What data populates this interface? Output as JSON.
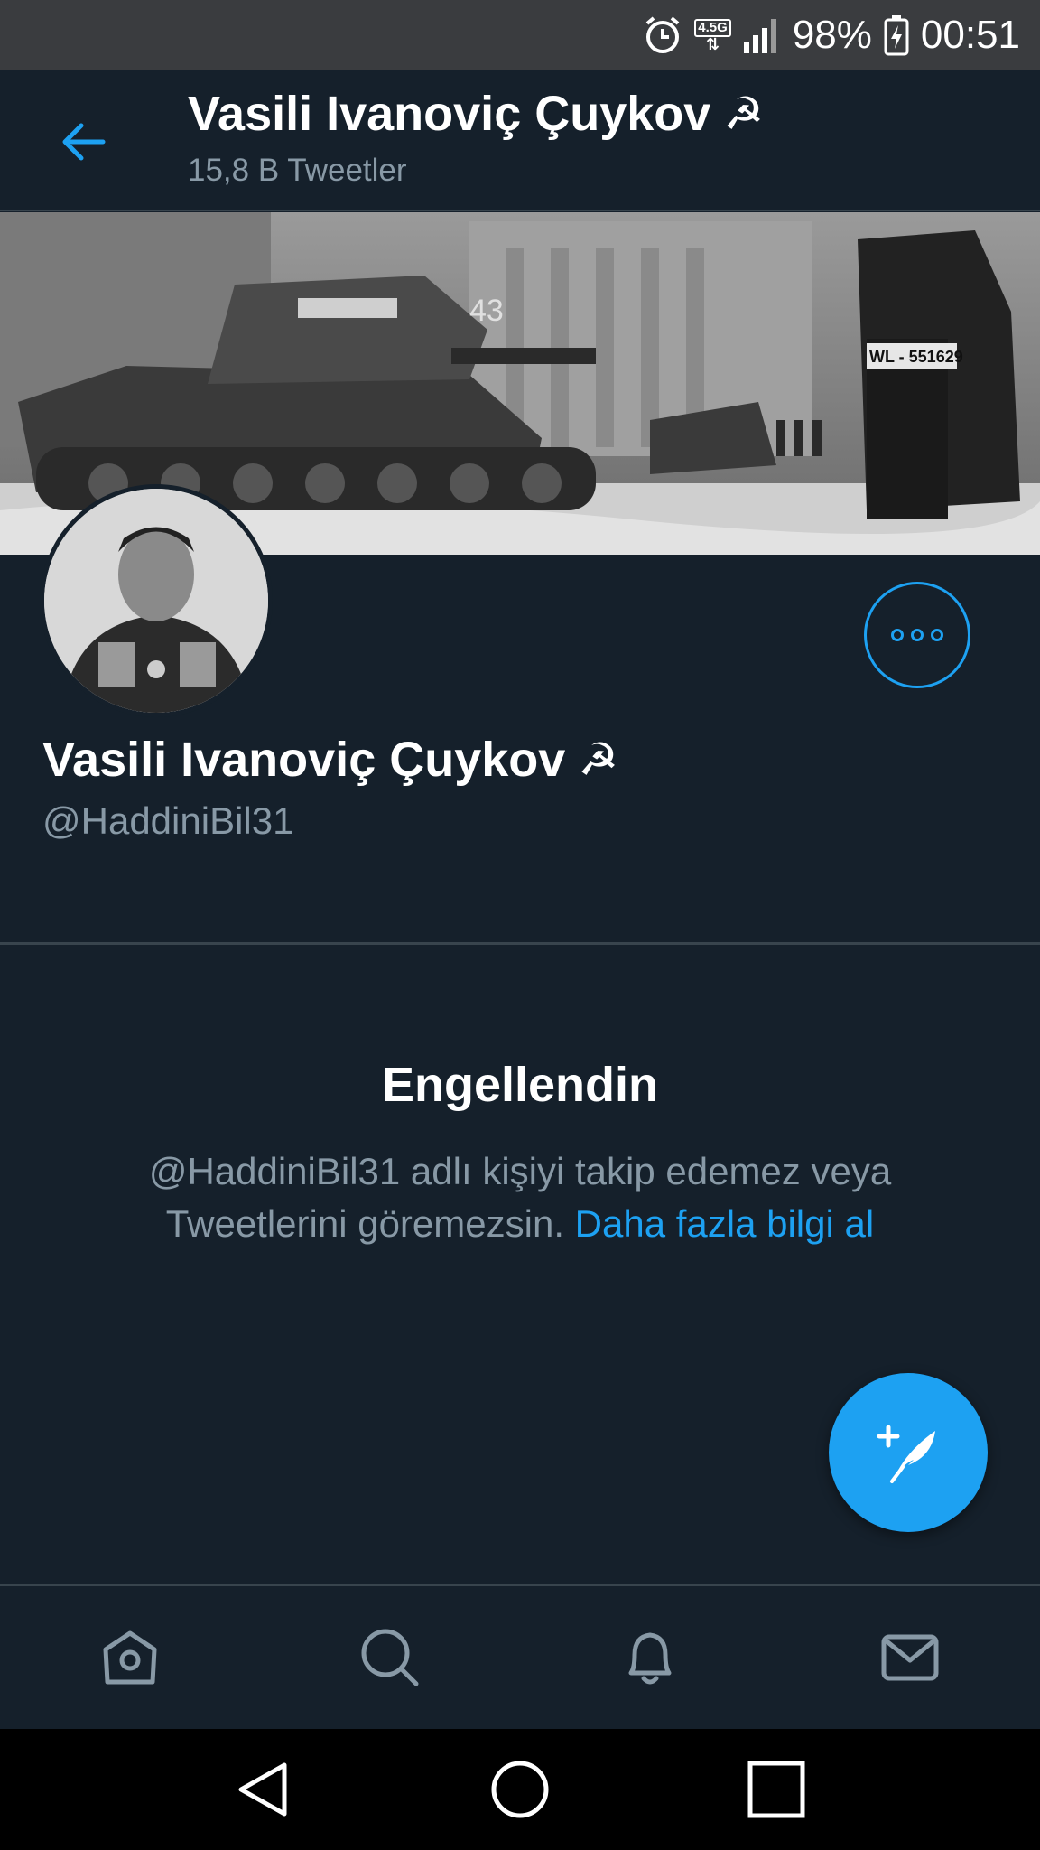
{
  "status_bar": {
    "network": "4.5G",
    "battery": "98%",
    "time": "00:51"
  },
  "header": {
    "title": "Vasili Ivanoviç Çuykov",
    "subtitle": "15,8 B Tweetler",
    "title_emoji": "☭"
  },
  "profile": {
    "name": "Vasili Ivanoviç Çuykov",
    "name_emoji": "☭",
    "handle": "@HaddiniBil31"
  },
  "blocked": {
    "title": "Engellendin",
    "message": "@HaddiniBil31 adlı kişiyi takip edemez veya Tweetlerini göremezsin.",
    "link": "Daha fazla bilgi al"
  },
  "banner": {
    "plate_text": "WL - 551629",
    "tank_number": "43"
  },
  "colors": {
    "background": "#15202b",
    "accent": "#1da1f2",
    "muted_text": "#8899a6",
    "divider": "#38444d"
  },
  "icons": {
    "back": "arrow-left-icon",
    "more": "more-options-icon",
    "compose": "compose-tweet-icon",
    "home": "home-icon",
    "search": "search-icon",
    "notifications": "bell-icon",
    "messages": "mail-icon"
  }
}
